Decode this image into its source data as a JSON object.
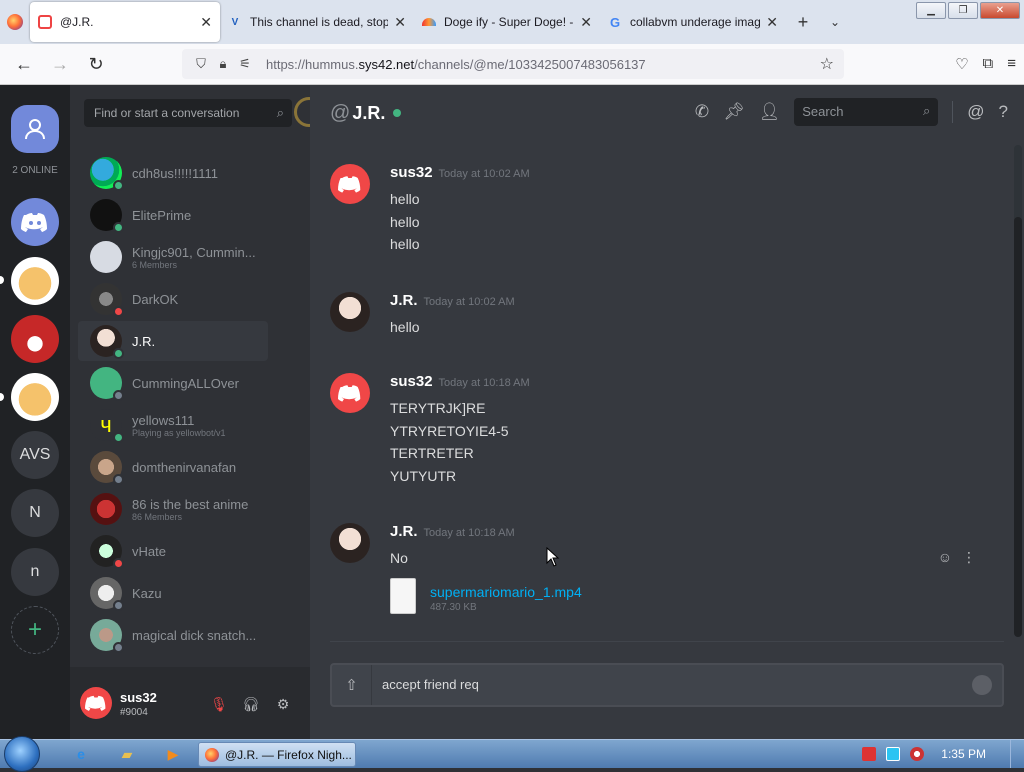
{
  "browser": {
    "tabs": [
      {
        "title": "@J.R.",
        "active": true
      },
      {
        "title": "This channel is dead, stop",
        "active": false
      },
      {
        "title": "Doge ify - Super Doge! - ",
        "active": false
      },
      {
        "title": "collabvm underage imag",
        "active": false
      }
    ],
    "new_tab": "+",
    "url_prefix": "https://hummus.",
    "url_domain": "sys42.net",
    "url_path": "/channels/@me/1033425007483056137"
  },
  "guilds": {
    "online_count": "2 ONLINE",
    "items": [
      {
        "label": "AVS"
      },
      {
        "label": "N"
      },
      {
        "label": "n"
      }
    ],
    "add": "+"
  },
  "dm_list": {
    "search_placeholder": "Find or start a conversation",
    "items": [
      {
        "name": "cdh8us!!!!!1111",
        "sub": "",
        "status": "on"
      },
      {
        "name": "ElitePrime",
        "sub": "",
        "status": "on"
      },
      {
        "name": "Kingjc901, Cummin...",
        "sub": "6 Members",
        "status": ""
      },
      {
        "name": "DarkOK",
        "sub": "",
        "status": "dnd"
      },
      {
        "name": "J.R.",
        "sub": "",
        "status": "on"
      },
      {
        "name": "CummingALLOver",
        "sub": "",
        "status": "off"
      },
      {
        "name": "yellows111",
        "sub": "Playing as yellowbot/v1",
        "status": "on"
      },
      {
        "name": "domthenirvanafan",
        "sub": "",
        "status": "off"
      },
      {
        "name": "86 is the best anime",
        "sub": "86 Members",
        "status": ""
      },
      {
        "name": "vHate",
        "sub": "",
        "status": "dnd"
      },
      {
        "name": "Kazu",
        "sub": "",
        "status": "off"
      },
      {
        "name": "magical dick snatch...",
        "sub": "",
        "status": "off"
      }
    ]
  },
  "user_panel": {
    "name": "sus32",
    "tag": "#9004"
  },
  "chat": {
    "at": "@",
    "title": "J.R.",
    "search_placeholder": "Search",
    "messages": [
      {
        "author": "sus32",
        "time": "Today at 10:02 AM",
        "lines": [
          "hello",
          "hello",
          "hello"
        ]
      },
      {
        "author": "J.R.",
        "time": "Today at 10:02 AM",
        "lines": [
          "hello"
        ]
      },
      {
        "author": "sus32",
        "time": "Today at 10:18 AM",
        "lines": [
          "TERYTRJK]RE",
          "YTRYRETOYIE4-5",
          "TERTRETER",
          "YUTYUTR"
        ]
      },
      {
        "author": "J.R.",
        "time": "Today at 10:18 AM",
        "lines": [
          "No"
        ]
      }
    ],
    "attachment": {
      "name": "supermariomario_1.mp4",
      "size": "487.30 KB"
    },
    "composer_text": "accept friend req"
  },
  "taskbar": {
    "window_title": "@J.R. — Firefox Nigh...",
    "clock": "1:35 PM"
  },
  "colors": {
    "discord_blurple": "#7289da",
    "online": "#43b581",
    "dnd": "#f04747",
    "link": "#00b0f4"
  }
}
